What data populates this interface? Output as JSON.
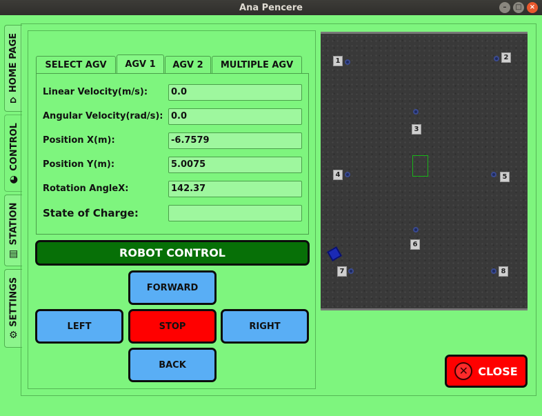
{
  "window": {
    "title": "Ana Pencere",
    "buttons": {
      "minimize": "–",
      "maximize": "□",
      "close": "×"
    }
  },
  "sidebar": {
    "tabs": [
      {
        "label": "HOME PAGE",
        "icon": "home-icon",
        "glyph": "⌂"
      },
      {
        "label": "CONTROL",
        "icon": "joystick-icon",
        "glyph": "◕"
      },
      {
        "label": "STATION",
        "icon": "station-icon",
        "glyph": "▤"
      },
      {
        "label": "SETTINGS",
        "icon": "gear-icon",
        "glyph": "⚙"
      }
    ],
    "active": "CONTROL"
  },
  "agv_tabs": {
    "items": [
      "SELECT AGV",
      "AGV 1",
      "AGV 2",
      "MULTIPLE AGV"
    ],
    "active": "AGV 1"
  },
  "telemetry": {
    "linear_velocity": {
      "label": "Linear Velocity(m/s):",
      "value": "0.0"
    },
    "angular_velocity": {
      "label": "Angular Velocity(rad/s):",
      "value": "0.0"
    },
    "position_x": {
      "label": "Position X(m):",
      "value": "-6.7579"
    },
    "position_y": {
      "label": "Position Y(m):",
      "value": "5.0075"
    },
    "rotation_angle": {
      "label": "Rotation AngleX:",
      "value": "142.37"
    },
    "state_of_charge": {
      "label": "State of Charge:",
      "value": ""
    }
  },
  "robot_control": {
    "title": "ROBOT CONTROL",
    "forward": "FORWARD",
    "left": "LEFT",
    "stop": "STOP",
    "right": "RIGHT",
    "back": "BACK"
  },
  "map": {
    "stations": [
      "1",
      "2",
      "3",
      "4",
      "5",
      "6",
      "7",
      "8"
    ]
  },
  "close_label": "CLOSE",
  "colors": {
    "background": "#7ef57e",
    "banner": "#077007",
    "control_button": "#59aef5",
    "stop_button": "#ff0000",
    "close_button": "#ff0000"
  }
}
